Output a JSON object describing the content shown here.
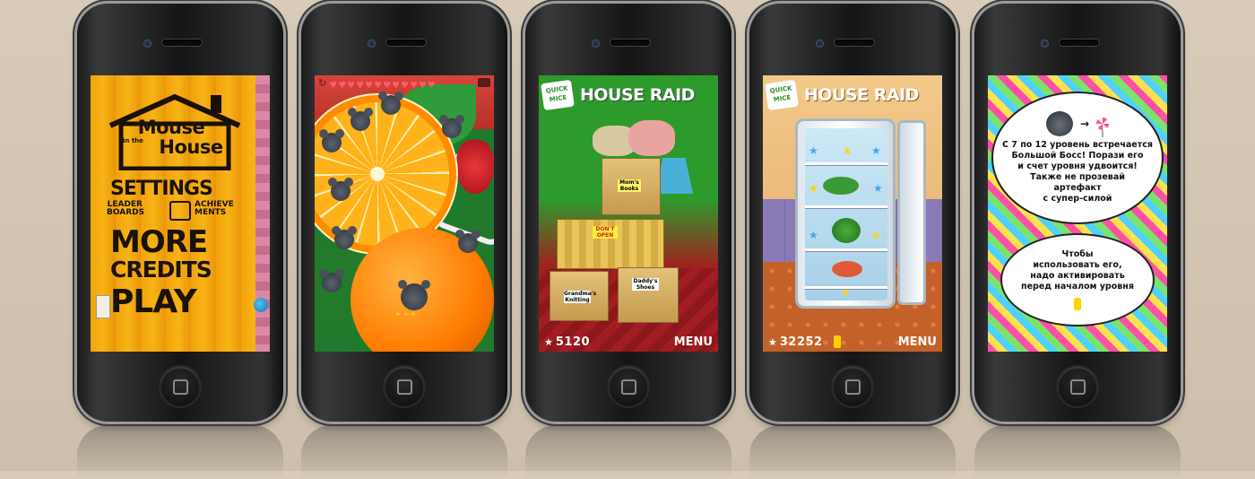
{
  "screens": {
    "menu": {
      "title_line1": "Mouse",
      "title_inthe": "in the",
      "title_line2": "House",
      "settings": "SETTINGS",
      "leaderboards": "LEADER BOARDS",
      "achievements": "ACHIEVE MENTS",
      "more": "MORE",
      "credits": "CREDITS",
      "play": "PLAY"
    },
    "fruit_level": {
      "hearts": [
        "♥",
        "♥",
        "♥",
        "♥",
        "♥",
        "♥",
        "♥",
        "♥",
        "♥",
        "♥",
        "♥",
        "♥"
      ]
    },
    "house_raid_1": {
      "logo": "QUICK MICE",
      "title": "HOUSE RAID",
      "box_labels": [
        "Mom's Books",
        "DON'T OPEN",
        "Grandma's Knitting",
        "Daddy's Shoes"
      ],
      "score": "5120",
      "menu": "MENU"
    },
    "house_raid_2": {
      "logo": "QUICK MICE",
      "title": "HOUSE RAID",
      "score": "32252",
      "menu": "MENU"
    },
    "candy_tip": {
      "bubble1": "С 7 по 12 уровень встречается\nБольшой Босс! Порази его\nи счет уровня удвоится!\nТакже не прозевай\nартефакт\nс супер-силой",
      "bubble2": "Чтобы\nиспользовать его,\nнадо активировать\nперед началом уровня"
    }
  },
  "colors": {
    "background": "#d3c5b1",
    "menu_orange": "#f2a20c",
    "raid_green": "#2d9a2c",
    "heart": "#ff5a6a",
    "star": "#ffd400"
  }
}
